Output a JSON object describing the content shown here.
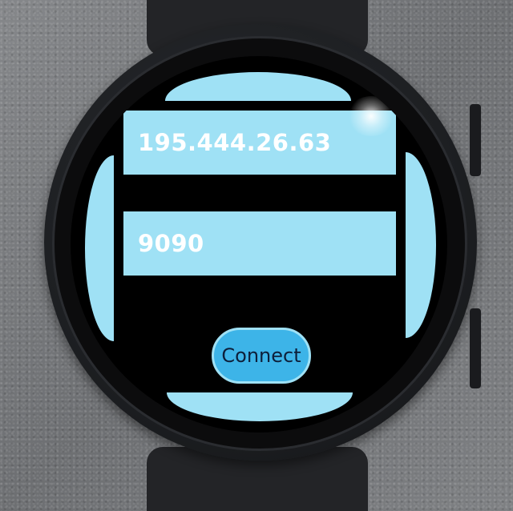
{
  "connection": {
    "ip_value": "195.444.26.63",
    "port_value": "9090",
    "connect_label": "Connect"
  },
  "colors": {
    "accent_light": "#9fe1f5",
    "button": "#3db4e8",
    "screen_bg": "#000000"
  }
}
